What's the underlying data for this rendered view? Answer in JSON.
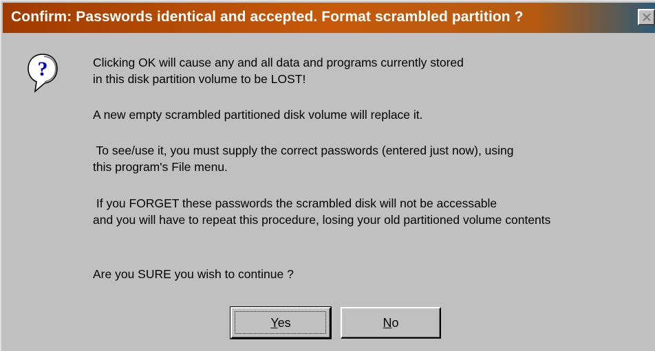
{
  "window": {
    "title": "Confirm: Passwords identical and accepted. Format scrambled partition ?",
    "close_icon": "close-icon",
    "titlebar_colors": [
      "#a03b00",
      "#c65a0a",
      "#2d5a78"
    ]
  },
  "icon": {
    "name": "question-icon",
    "glyph": "?",
    "color": "#0000c0"
  },
  "message": {
    "line1": "Clicking OK will cause any and all data and programs currently stored",
    "line2": "in this disk partition volume to be LOST!",
    "line3": "A new empty scrambled partitioned disk volume will replace it.",
    "line4": " To see/use it, you must supply the correct passwords (entered just now), using",
    "line5": "this program's File menu.",
    "line6": " If you FORGET these passwords the scrambled disk will not be accessable",
    "line7": "and you will have to repeat this procedure, losing your old partitioned volume contents",
    "question": "Are you SURE you wish to continue ?"
  },
  "buttons": {
    "yes": {
      "mnemonic": "Y",
      "rest": "es"
    },
    "no": {
      "mnemonic": "N",
      "rest": "o"
    }
  }
}
